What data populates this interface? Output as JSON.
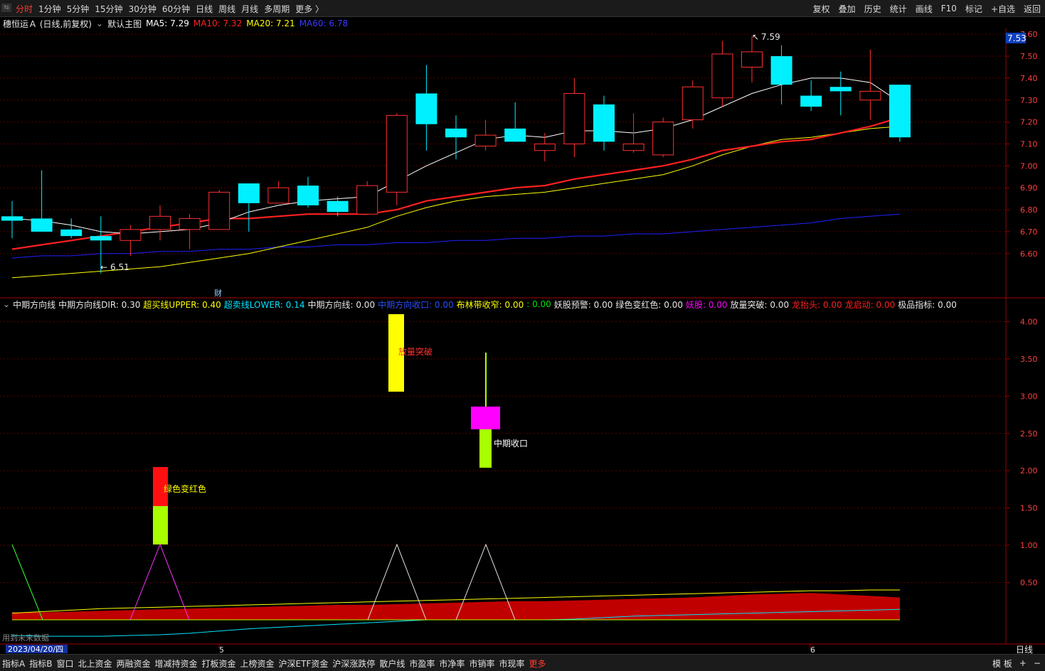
{
  "topbar": {
    "tabs": [
      "分时",
      "1分钟",
      "5分钟",
      "15分钟",
      "30分钟",
      "60分钟",
      "日线",
      "周线",
      "月线",
      "多周期",
      "更多 〉"
    ],
    "active_index": 0,
    "tools": [
      "复权",
      "叠加",
      "历史",
      "统计",
      "画线",
      "F10",
      "标记",
      "+自选",
      "返回"
    ]
  },
  "main_header": {
    "stock_name": "穗恒运Ａ (日线,前复权)",
    "template": "默认主图",
    "ma5_label": "MA5: 7.29",
    "ma10_label": "MA10: 7.32",
    "ma20_label": "MA20: 7.21",
    "ma60_label": "MA60: 6.78",
    "colors": {
      "ma5": "#ffffff",
      "ma10": "#ff2020",
      "ma20": "#ffff00",
      "ma60": "#2020ff"
    }
  },
  "indicator_header": {
    "name": "中期方向线",
    "items": [
      {
        "text": "中期方向线DIR: 0.30",
        "color": "#e6e6e6"
      },
      {
        "text": "超买线UPPER: 0.40",
        "color": "#ffff00"
      },
      {
        "text": "超卖线LOWER: 0.14",
        "color": "#00e5ff"
      },
      {
        "text": "中期方向线: 0.00",
        "color": "#e6e6e6"
      },
      {
        "text": "中期方向收口: 0.00",
        "color": "#2a4dff"
      },
      {
        "text": "布林带收窄: 0.00",
        "color": "#ffff00"
      },
      {
        "text": ": 0.00",
        "color": "#00e000"
      },
      {
        "text": "妖股预警: 0.00",
        "color": "#e6e6e6"
      },
      {
        "text": "绿色变红色: 0.00",
        "color": "#e6e6e6"
      },
      {
        "text": "妖股: 0.00",
        "color": "#ff00ff"
      },
      {
        "text": "放量突破: 0.00",
        "color": "#e6e6e6"
      },
      {
        "text": "龙抬头: 0.00",
        "color": "#ff2020"
      },
      {
        "text": "龙启动: 0.00",
        "color": "#ff2020"
      },
      {
        "text": "极品指标: 0.00",
        "color": "#e6e6e6"
      }
    ]
  },
  "chart_data": [
    {
      "type": "candlestick",
      "y_ticks": [
        "7.60",
        "7.50",
        "7.40",
        "7.30",
        "7.20",
        "7.10",
        "7.00",
        "6.90",
        "6.80",
        "6.70",
        "6.60"
      ],
      "ylim": [
        6.46,
        7.62
      ],
      "current_price": "7.53",
      "annotations": {
        "high": "7.59",
        "low": "6.51",
        "finance_marker": "财"
      },
      "candles": [
        {
          "o": 6.77,
          "h": 6.84,
          "l": 6.67,
          "c": 6.75
        },
        {
          "o": 6.76,
          "h": 6.98,
          "l": 6.73,
          "c": 6.7
        },
        {
          "o": 6.71,
          "h": 6.76,
          "l": 6.67,
          "c": 6.68
        },
        {
          "o": 6.68,
          "h": 6.77,
          "l": 6.51,
          "c": 6.66
        },
        {
          "o": 6.66,
          "h": 6.73,
          "l": 6.59,
          "c": 6.71
        },
        {
          "o": 6.71,
          "h": 6.82,
          "l": 6.66,
          "c": 6.77
        },
        {
          "o": 6.71,
          "h": 6.78,
          "l": 6.62,
          "c": 6.76
        },
        {
          "o": 6.71,
          "h": 6.89,
          "l": 6.71,
          "c": 6.88
        },
        {
          "o": 6.92,
          "h": 6.92,
          "l": 6.7,
          "c": 6.83
        },
        {
          "o": 6.83,
          "h": 6.93,
          "l": 6.83,
          "c": 6.9
        },
        {
          "o": 6.91,
          "h": 6.95,
          "l": 6.81,
          "c": 6.82
        },
        {
          "o": 6.84,
          "h": 6.86,
          "l": 6.77,
          "c": 6.79
        },
        {
          "o": 6.78,
          "h": 6.93,
          "l": 6.78,
          "c": 6.91
        },
        {
          "o": 6.88,
          "h": 7.24,
          "l": 6.82,
          "c": 7.23
        },
        {
          "o": 7.33,
          "h": 7.46,
          "l": 7.07,
          "c": 7.19
        },
        {
          "o": 7.17,
          "h": 7.23,
          "l": 7.03,
          "c": 7.13
        },
        {
          "o": 7.09,
          "h": 7.21,
          "l": 7.07,
          "c": 7.14
        },
        {
          "o": 7.17,
          "h": 7.29,
          "l": 7.11,
          "c": 7.11
        },
        {
          "o": 7.07,
          "h": 7.15,
          "l": 7.02,
          "c": 7.1
        },
        {
          "o": 7.1,
          "h": 7.4,
          "l": 7.04,
          "c": 7.33
        },
        {
          "o": 7.28,
          "h": 7.32,
          "l": 7.07,
          "c": 7.11
        },
        {
          "o": 7.07,
          "h": 7.24,
          "l": 7.06,
          "c": 7.1
        },
        {
          "o": 7.05,
          "h": 7.22,
          "l": 7.04,
          "c": 7.2
        },
        {
          "o": 7.21,
          "h": 7.39,
          "l": 7.17,
          "c": 7.36
        },
        {
          "o": 7.31,
          "h": 7.57,
          "l": 7.27,
          "c": 7.51
        },
        {
          "o": 7.45,
          "h": 7.59,
          "l": 7.38,
          "c": 7.52
        },
        {
          "o": 7.5,
          "h": 7.55,
          "l": 7.28,
          "c": 7.37
        },
        {
          "o": 7.32,
          "h": 7.39,
          "l": 7.25,
          "c": 7.27
        },
        {
          "o": 7.36,
          "h": 7.43,
          "l": 7.23,
          "c": 7.34
        },
        {
          "o": 7.3,
          "h": 7.53,
          "l": 7.21,
          "c": 7.34
        },
        {
          "o": 7.37,
          "h": 7.37,
          "l": 7.11,
          "c": 7.13
        }
      ],
      "ma5": [
        6.76,
        6.75,
        6.73,
        6.7,
        6.69,
        6.7,
        6.71,
        6.74,
        6.79,
        6.82,
        6.84,
        6.85,
        6.86,
        6.93,
        7.0,
        7.06,
        7.12,
        7.14,
        7.13,
        7.16,
        7.16,
        7.15,
        7.17,
        7.21,
        7.27,
        7.33,
        7.37,
        7.4,
        7.4,
        7.38,
        7.29
      ],
      "ma10": [
        6.62,
        6.64,
        6.66,
        6.68,
        6.7,
        6.72,
        6.74,
        6.76,
        6.76,
        6.77,
        6.78,
        6.78,
        6.78,
        6.8,
        6.84,
        6.86,
        6.88,
        6.9,
        6.91,
        6.94,
        6.96,
        6.98,
        7.0,
        7.03,
        7.07,
        7.09,
        7.11,
        7.12,
        7.15,
        7.18,
        7.22
      ],
      "ma20": [
        6.49,
        6.5,
        6.51,
        6.52,
        6.53,
        6.54,
        6.56,
        6.58,
        6.6,
        6.63,
        6.66,
        6.69,
        6.72,
        6.77,
        6.81,
        6.84,
        6.86,
        6.87,
        6.88,
        6.9,
        6.92,
        6.94,
        6.96,
        7.0,
        7.05,
        7.09,
        7.12,
        7.13,
        7.15,
        7.17,
        7.18
      ],
      "ma60": [
        6.58,
        6.59,
        6.59,
        6.6,
        6.6,
        6.61,
        6.61,
        6.62,
        6.62,
        6.63,
        6.63,
        6.64,
        6.64,
        6.65,
        6.65,
        6.66,
        6.66,
        6.67,
        6.67,
        6.68,
        6.68,
        6.69,
        6.69,
        6.7,
        6.71,
        6.72,
        6.73,
        6.74,
        6.76,
        6.77,
        6.78
      ]
    },
    {
      "type": "indicator",
      "y_ticks": [
        "4.00",
        "3.50",
        "3.00",
        "2.50",
        "2.00",
        "1.50",
        "1.00",
        "0.50"
      ],
      "ylim": [
        0,
        4.1
      ],
      "dir_area": [
        0.1,
        0.1,
        0.11,
        0.12,
        0.13,
        0.14,
        0.15,
        0.16,
        0.17,
        0.18,
        0.19,
        0.2,
        0.2,
        0.21,
        0.22,
        0.23,
        0.24,
        0.25,
        0.25,
        0.26,
        0.27,
        0.28,
        0.29,
        0.3,
        0.32,
        0.34,
        0.35,
        0.36,
        0.34,
        0.32,
        0.3
      ],
      "upper": [
        0.09,
        0.11,
        0.13,
        0.15,
        0.16,
        0.17,
        0.18,
        0.19,
        0.2,
        0.21,
        0.22,
        0.23,
        0.24,
        0.25,
        0.26,
        0.27,
        0.28,
        0.29,
        0.3,
        0.31,
        0.32,
        0.33,
        0.34,
        0.35,
        0.36,
        0.37,
        0.38,
        0.39,
        0.39,
        0.4,
        0.4
      ],
      "lower": [
        -0.21,
        -0.22,
        -0.22,
        -0.22,
        -0.21,
        -0.2,
        -0.18,
        -0.15,
        -0.12,
        -0.1,
        -0.08,
        -0.06,
        -0.04,
        -0.02,
        0.0,
        0.0,
        0.0,
        0.0,
        0.0,
        0.01,
        0.03,
        0.05,
        0.06,
        0.07,
        0.08,
        0.09,
        0.1,
        0.11,
        0.12,
        0.13,
        0.14
      ],
      "labels": {
        "green_to_red": "绿色变红色",
        "volume_break": "放量突破",
        "mid_converge": "中期收口"
      },
      "warn_text": "用到未来数据"
    }
  ],
  "x_axis": {
    "date_label": "2023/04/20/四",
    "month_5": "5",
    "month_6": "6",
    "period": "日线"
  },
  "bottombar": {
    "items": [
      "指标A",
      "指标B",
      "窗口",
      "北上资金",
      "两融资金",
      "增减持资金",
      "打板资金",
      "上榜资金",
      "沪深ETF资金",
      "沪深涨跌停",
      "散户线",
      "市盈率",
      "市净率",
      "市销率",
      "市现率",
      "更多"
    ],
    "right": [
      "模 板",
      "+",
      "−"
    ]
  }
}
